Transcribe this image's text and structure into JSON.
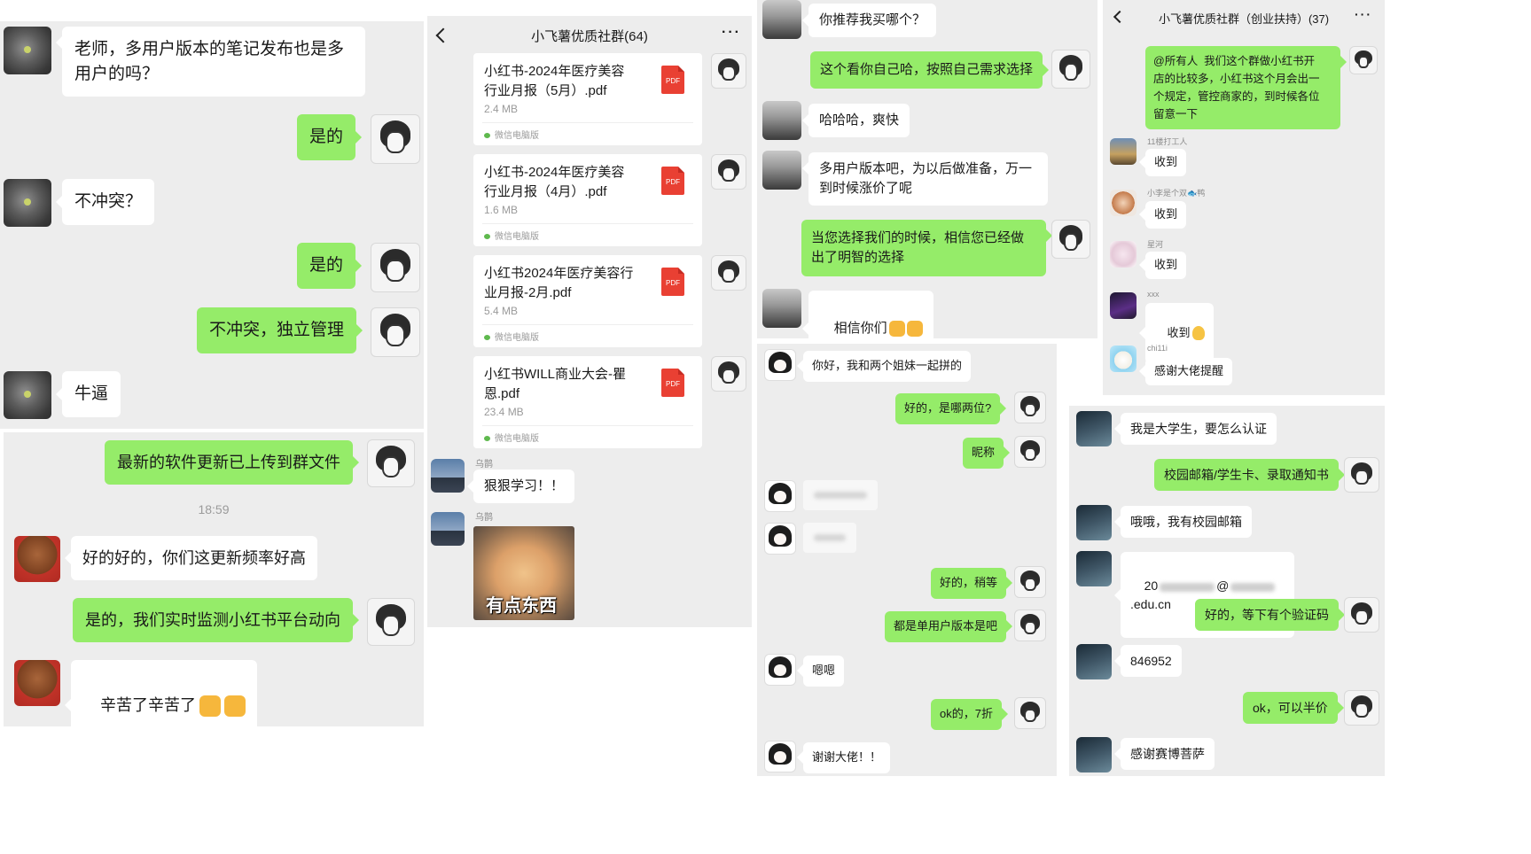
{
  "panel1": {
    "messages": [
      {
        "text": "老师，多用户版本的笔记发布也是多\n用户的吗？"
      },
      {
        "text": "是的"
      },
      {
        "text": "不冲突？"
      },
      {
        "text": "是的"
      },
      {
        "text": "不冲突，独立管理"
      },
      {
        "text": "牛逼"
      },
      {
        "text": "最新的软件更新已上传到群文件"
      },
      {
        "text": "好的好的，你们这更新频率好高"
      },
      {
        "text": "是的，我们实时监测小红书平台动向"
      },
      {
        "text": "辛苦了辛苦了"
      }
    ],
    "time": "18:59"
  },
  "panel2": {
    "title": "小飞薯优质社群(64)",
    "more": "···",
    "files": [
      {
        "name": "小红书-2024年医疗美容\n行业月报（5月）.pdf",
        "size": "2.4 MB",
        "source": "微信电脑版",
        "badge": "PDF"
      },
      {
        "name": "小红书-2024年医疗美容\n行业月报（4月）.pdf",
        "size": "1.6 MB",
        "source": "微信电脑版",
        "badge": "PDF"
      },
      {
        "name": "小红书2024年医疗美容行\n业月报-2月.pdf",
        "size": "5.4 MB",
        "source": "微信电脑版",
        "badge": "PDF"
      },
      {
        "name": "小红书WILL商业大会-瞿\n恩.pdf",
        "size": "23.4 MB",
        "source": "微信电脑版",
        "badge": "PDF"
      }
    ],
    "sender1": "乌鹊",
    "msg1": "狠狠学习！！",
    "sender2": "乌鹊",
    "image_caption": "有点东西"
  },
  "panel3": {
    "messages": [
      {
        "text": "你推荐我买哪个？"
      },
      {
        "text": "这个看你自己哈，按照自己需求选择"
      },
      {
        "text": "哈哈哈，爽快"
      },
      {
        "text": "多用户版本吧，为以后做准备，万一\n到时候涨价了呢"
      },
      {
        "text": "当您选择我们的时候，相信您已经做\n出了明智的选择"
      },
      {
        "text": "相信你们"
      }
    ]
  },
  "panel4": {
    "messages": [
      {
        "text": "你好，我和两个姐妹一起拼的"
      },
      {
        "text": "好的，是哪两位?"
      },
      {
        "text": "昵称"
      },
      {
        "text": "好的，稍等"
      },
      {
        "text": "都是单用户版本是吧"
      },
      {
        "text": "嗯嗯"
      },
      {
        "text": "ok的，7折"
      },
      {
        "text": "谢谢大佬！！"
      }
    ]
  },
  "panel5": {
    "title": "小飞薯优质社群（创业扶持）(37)",
    "more": "···",
    "announcement": "@所有人  我们这个群做小红书开\n店的比较多，小红书这个月会出一\n个规定，管控商家的，到时候各位\n留意一下",
    "replies": [
      {
        "sender": "11楼打工人",
        "text": "收到"
      },
      {
        "sender": "小李是个双🐟鸭",
        "text": "收到"
      },
      {
        "sender": "星河",
        "text": "收到"
      },
      {
        "sender": "xxx",
        "text": "收到"
      },
      {
        "sender": "chi11i",
        "text": "感谢大佬提醒"
      }
    ]
  },
  "panel6": {
    "messages": [
      {
        "text": "我是大学生，要怎么认证"
      },
      {
        "text": "校园邮箱/学生卡、录取通知书"
      },
      {
        "text": "哦哦，我有校园邮箱"
      },
      {
        "email_prefix": "20",
        "email_at": "@",
        "email_suffix": ".edu.cn"
      },
      {
        "text": "好的，等下有个验证码"
      },
      {
        "text": "846952"
      },
      {
        "text": "ok，可以半价"
      },
      {
        "text": "感谢赛博菩萨"
      }
    ]
  }
}
